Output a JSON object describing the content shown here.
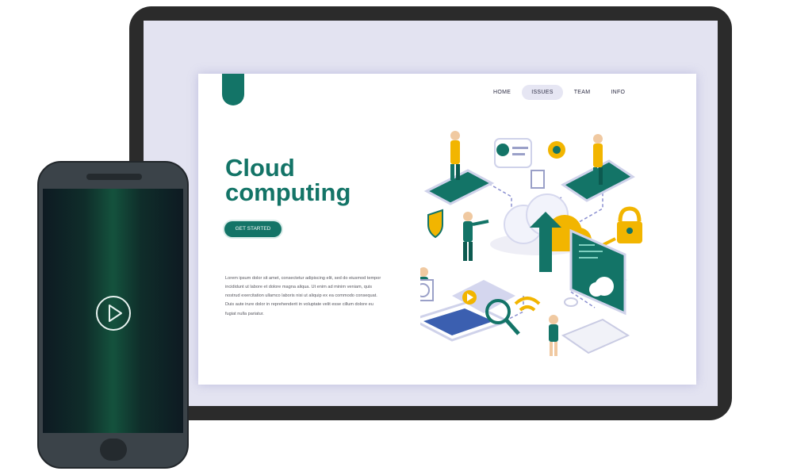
{
  "website": {
    "nav": {
      "items": [
        {
          "label": "HOME",
          "active": false
        },
        {
          "label": "ISSUES",
          "active": true
        },
        {
          "label": "TEAM",
          "active": false
        },
        {
          "label": "INFO",
          "active": false
        }
      ]
    },
    "hero": {
      "title_line1": "Cloud",
      "title_line2": "computing",
      "cta_label": "GET STARTED",
      "body": "Lorem ipsum dolor sit amet, consectetur adipiscing elit, sed do eiusmod tempor incididunt ut labore et dolore magna aliqua. Ut enim ad minim veniam, quis nostrud exercitation ullamco laboris nisi ut aliquip ex ea commodo consequat. Duis aute irure dolor in reprehenderit in voluptate velit esse cillum dolore eu fugiat nulla pariatur."
    }
  },
  "phone": {
    "play_icon": "play-icon"
  },
  "colors": {
    "brand": "#137467",
    "accent_yellow": "#f2b500",
    "monitor_frame": "#2b2b2b",
    "phone_body": "#3b4349"
  }
}
